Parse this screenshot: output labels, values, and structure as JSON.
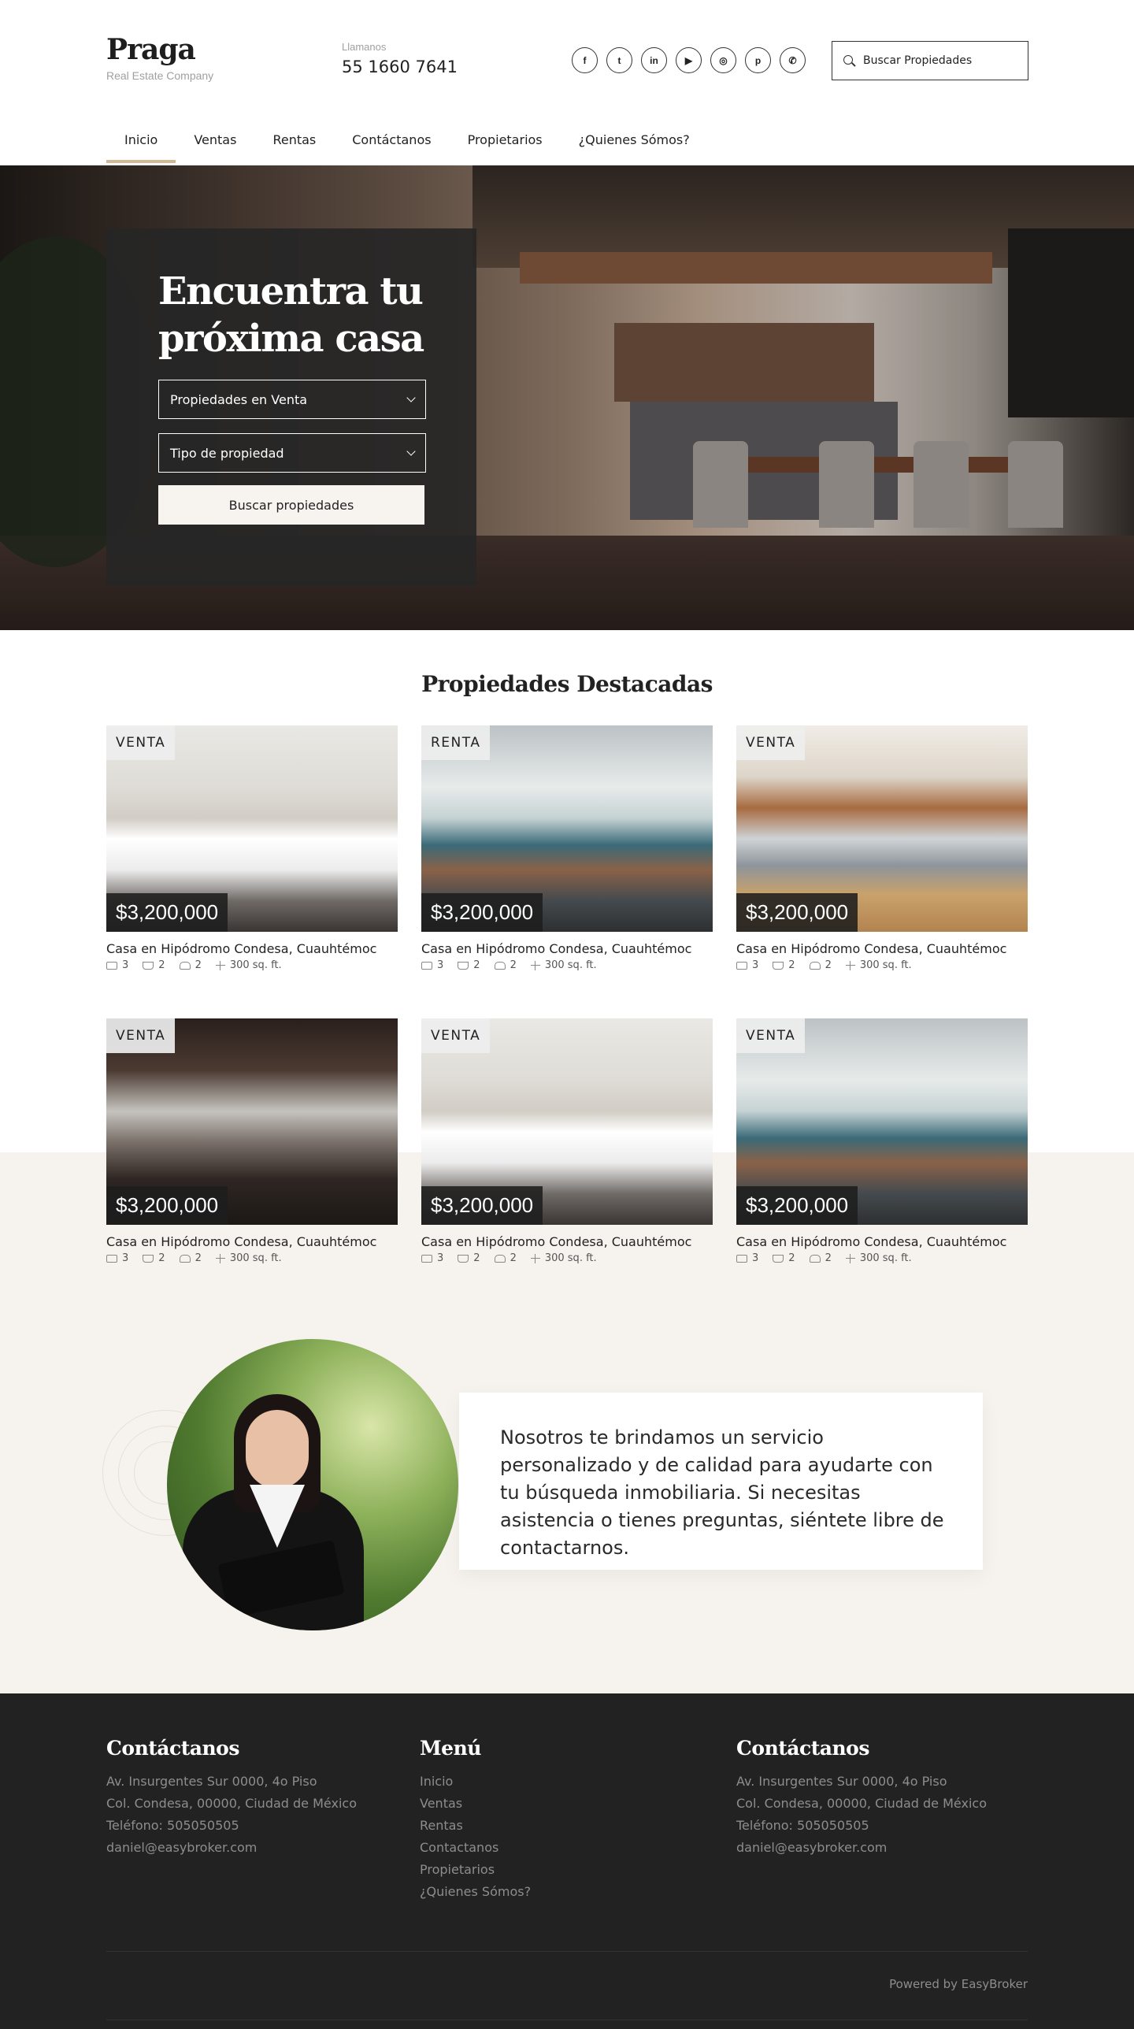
{
  "header": {
    "brand": {
      "name": "Praga",
      "tagline": "Real Estate Company"
    },
    "callus": {
      "label": "Llamanos",
      "phone": "55 1660 7641"
    },
    "socials": [
      {
        "icon": "facebook-icon",
        "glyph": "f"
      },
      {
        "icon": "twitter-icon",
        "glyph": "t"
      },
      {
        "icon": "linkedin-icon",
        "glyph": "in"
      },
      {
        "icon": "youtube-icon",
        "glyph": "▶"
      },
      {
        "icon": "instagram-icon",
        "glyph": "◎"
      },
      {
        "icon": "pinterest-icon",
        "glyph": "p"
      },
      {
        "icon": "whatsapp-icon",
        "glyph": "✆"
      }
    ],
    "search": {
      "placeholder": "Buscar Propiedades"
    }
  },
  "nav": {
    "items": [
      {
        "label": "Inicio",
        "active": true
      },
      {
        "label": "Ventas"
      },
      {
        "label": "Rentas"
      },
      {
        "label": "Contáctanos"
      },
      {
        "label": "Propietarios"
      },
      {
        "label": "¿Quienes Sómos?"
      }
    ]
  },
  "hero": {
    "title_line1": "Encuentra tu",
    "title_line2": "próxima casa",
    "operation_select": "Propiedades en Venta",
    "type_select": "Tipo de propiedad",
    "button": "Buscar propiedades"
  },
  "featured": {
    "title": "Propiedades Destacadas",
    "cards": [
      {
        "badge": "VENTA",
        "price": "$3,200,000",
        "title": "Casa en Hipódromo Condesa, Cuauhtémoc",
        "beds": "3",
        "baths": "2",
        "parking": "2",
        "area": "300 sq. ft."
      },
      {
        "badge": "RENTA",
        "price": "$3,200,000",
        "title": "Casa en Hipódromo Condesa, Cuauhtémoc",
        "beds": "3",
        "baths": "2",
        "parking": "2",
        "area": "300 sq. ft."
      },
      {
        "badge": "VENTA",
        "price": "$3,200,000",
        "title": "Casa en Hipódromo Condesa, Cuauhtémoc",
        "beds": "3",
        "baths": "2",
        "parking": "2",
        "area": "300 sq. ft."
      },
      {
        "badge": "VENTA",
        "price": "$3,200,000",
        "title": "Casa en Hipódromo Condesa, Cuauhtémoc",
        "beds": "3",
        "baths": "2",
        "parking": "2",
        "area": "300 sq. ft."
      },
      {
        "badge": "VENTA",
        "price": "$3,200,000",
        "title": "Casa en Hipódromo Condesa, Cuauhtémoc",
        "beds": "3",
        "baths": "2",
        "parking": "2",
        "area": "300 sq. ft."
      },
      {
        "badge": "VENTA",
        "price": "$3,200,000",
        "title": "Casa en Hipódromo Condesa, Cuauhtémoc",
        "beds": "3",
        "baths": "2",
        "parking": "2",
        "area": "300 sq. ft."
      }
    ]
  },
  "about": {
    "text": "Nosotros te brindamos un servicio personalizado y de calidad para ayudarte con tu búsqueda inmobiliaria. Si necesitas asistencia o tienes preguntas, siéntete libre de contactarnos."
  },
  "footer": {
    "contact1": {
      "title": "Contáctanos",
      "address1": "Av. Insurgentes Sur 0000, 4o Piso",
      "address2": "Col. Condesa, 00000, Ciudad de México",
      "phone": "Teléfono: 505050505",
      "email": "daniel@easybroker.com"
    },
    "menu": {
      "title": "Menú",
      "items": [
        "Inicio",
        "Ventas",
        "Rentas",
        "Contactanos",
        "Propietarios",
        "¿Quienes Sómos?"
      ]
    },
    "contact2": {
      "title": "Contáctanos",
      "address1": "Av. Insurgentes Sur 0000, 4o Piso",
      "address2": "Col. Condesa, 00000, Ciudad de México",
      "phone": "Teléfono: 505050505",
      "email": "daniel@easybroker.com"
    },
    "powered": "Powered by EasyBroker"
  },
  "colors": {
    "accent": "#d4b896",
    "beige": "#f6f3ee",
    "footer_bg": "#222222",
    "dark_panel": "#262626"
  }
}
